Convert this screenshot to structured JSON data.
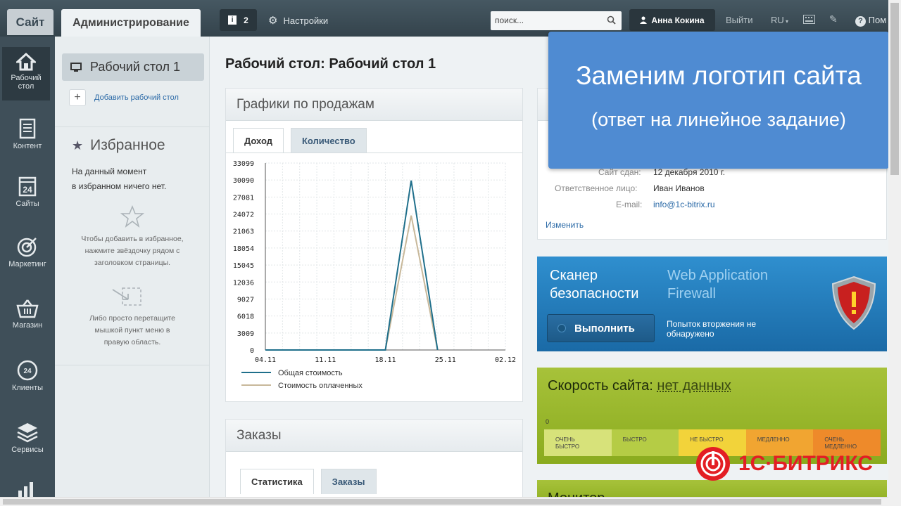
{
  "topbar": {
    "site_tab": "Сайт",
    "admin_tab": "Администрирование",
    "notif_count": "2",
    "settings": "Настройки",
    "search_placeholder": "поиск...",
    "user": "Анна Кокина",
    "logout": "Выйти",
    "lang": "RU",
    "help": "Пом"
  },
  "leftnav": [
    {
      "label1": "Рабочий",
      "label2": "стол",
      "icon": "home-icon"
    },
    {
      "label1": "Контент",
      "label2": "",
      "icon": "document-icon"
    },
    {
      "label1": "Сайты",
      "label2": "",
      "icon": "calendar-24-icon"
    },
    {
      "label1": "Маркетинг",
      "label2": "",
      "icon": "target-icon"
    },
    {
      "label1": "Магазин",
      "label2": "",
      "icon": "basket-icon"
    },
    {
      "label1": "Клиенты",
      "label2": "",
      "icon": "clients-24-icon"
    },
    {
      "label1": "Сервисы",
      "label2": "",
      "icon": "layers-icon"
    }
  ],
  "sidebar": {
    "desktop": "Рабочий стол 1",
    "add_desktop": "Добавить рабочий стол",
    "fav_title": "Избранное",
    "fav_line1": "На данный момент",
    "fav_line2": "в избранном ничего нет.",
    "hint1_l1": "Чтобы добавить в избранное,",
    "hint1_l2": "нажмите звёздочку рядом с",
    "hint1_l3": "заголовком страницы.",
    "hint2_l1": "Либо просто перетащите",
    "hint2_l2": "мышкой пункт меню в",
    "hint2_l3": "правую область."
  },
  "main": {
    "title": "Рабочий стол: Рабочий стол 1",
    "sales_panel": "Графики по продажам",
    "tab_income": "Доход",
    "tab_qty": "Количество",
    "orders_panel": "Заказы",
    "tab_stats": "Статистика",
    "tab_orders": "Заказы"
  },
  "chart_data": {
    "type": "line",
    "x": [
      "04.11",
      "11.11",
      "18.11",
      "25.11",
      "02.12"
    ],
    "yticks": [
      0,
      3009,
      6018,
      9027,
      12036,
      15045,
      18054,
      21063,
      24072,
      27081,
      30090,
      33099
    ],
    "ylim": [
      0,
      33099
    ],
    "series": [
      {
        "name": "Общая стоимость",
        "color": "#1f6f8b",
        "points": [
          [
            0,
            0
          ],
          [
            1,
            0
          ],
          [
            2,
            0
          ],
          [
            2.43,
            30000
          ],
          [
            2.87,
            0
          ]
        ]
      },
      {
        "name": "Стоимость оплаченных",
        "color": "#c8b89a",
        "points": [
          [
            0,
            0
          ],
          [
            1,
            0
          ],
          [
            2,
            0
          ],
          [
            2.43,
            23800
          ],
          [
            2.87,
            0
          ]
        ]
      }
    ]
  },
  "site_info": {
    "date_label": "Сайт сдан:",
    "date_value": "12 декабря 2010 г.",
    "resp_label": "Ответственное лицо:",
    "resp_value": "Иван Иванов",
    "email_label": "E-mail:",
    "email_value": "info@1c-bitrix.ru",
    "edit": "Изменить"
  },
  "scanner": {
    "title1": "Сканер",
    "title2": "безопасности",
    "waf1": "Web Application",
    "waf2": "Firewall",
    "run": "Выполнить",
    "status1": "Попыток вторжения не",
    "status2": "обнаружено"
  },
  "speed": {
    "title": "Скорость сайта:",
    "value": "нет данных",
    "zero": "0",
    "scale": [
      {
        "l1": "ОЧЕНЬ",
        "l2": "БЫСТРО",
        "color": "#d7e27a"
      },
      {
        "l1": "БЫСТРО",
        "l2": "",
        "color": "#b5cc45"
      },
      {
        "l1": "НЕ БЫСТРО",
        "l2": "",
        "color": "#f2d33a"
      },
      {
        "l1": "МЕДЛЕННО",
        "l2": "",
        "color": "#f1a531"
      },
      {
        "l1": "ОЧЕНЬ",
        "l2": "МЕДЛЕННО",
        "color": "#ee8a2a"
      }
    ]
  },
  "monitor": "Монитор",
  "overlay": {
    "title": "Заменим логотип сайта",
    "subtitle": "(ответ на линейное задание)"
  },
  "brand": "1С·БИТРИКС"
}
